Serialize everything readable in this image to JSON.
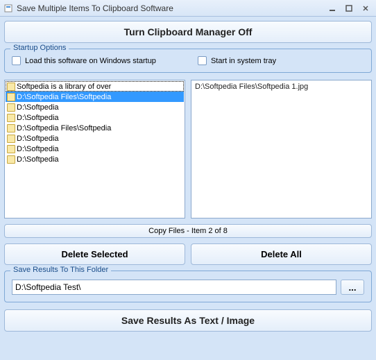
{
  "window": {
    "title": "Save Multiple Items To Clipboard Software"
  },
  "main_button": "Turn Clipboard Manager Off",
  "startup": {
    "legend": "Startup Options",
    "load_on_startup": "Load this software on Windows startup",
    "system_tray": "Start in system tray"
  },
  "list": {
    "items": [
      "Softpedia is a library of over",
      "D:\\Softpedia Files\\Softpedia",
      "D:\\Softpedia",
      "D:\\Softpedia",
      "D:\\Softpedia Files\\Softpedia",
      "D:\\Softpedia",
      "D:\\Softpedia",
      "D:\\Softpedia"
    ]
  },
  "preview": {
    "text": "D:\\Softpedia Files\\Softpedia 1.jpg"
  },
  "status": "Copy Files - Item 2 of 8",
  "actions": {
    "delete_selected": "Delete Selected",
    "delete_all": "Delete All"
  },
  "save_folder": {
    "legend": "Save Results To This Folder",
    "path": "D:\\Softpedia Test\\",
    "browse": "..."
  },
  "save_results": "Save Results As Text / Image"
}
